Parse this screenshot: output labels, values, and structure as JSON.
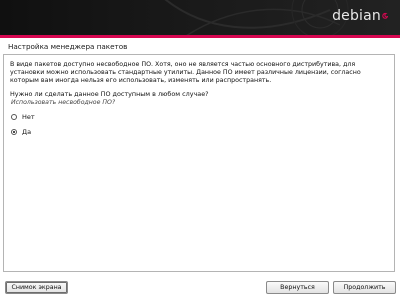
{
  "banner": {
    "logo_text": "debian",
    "logo_icon": "debian-swirl-icon",
    "accent_color": "#d70751"
  },
  "title": "Настройка менеджера пакетов",
  "description": [
    "В виде пакетов доступно несвободное ПО. Хотя, оно не является частью основного дистрибутива, для",
    "установки можно использовать стандартные утилиты. Данное ПО имеет различные лицензии, согласно",
    "которым вам иногда нельзя его использовать, изменять или распространять."
  ],
  "question": "Нужно ли сделать данное ПО доступным в любом случае?",
  "prompt": "Использовать несвободное ПО?",
  "options": [
    {
      "label": "Нет",
      "selected": false
    },
    {
      "label": "Да",
      "selected": true
    }
  ],
  "buttons": {
    "screenshot": "Снимок экрана",
    "back": "Вернуться",
    "continue": "Продолжить"
  }
}
